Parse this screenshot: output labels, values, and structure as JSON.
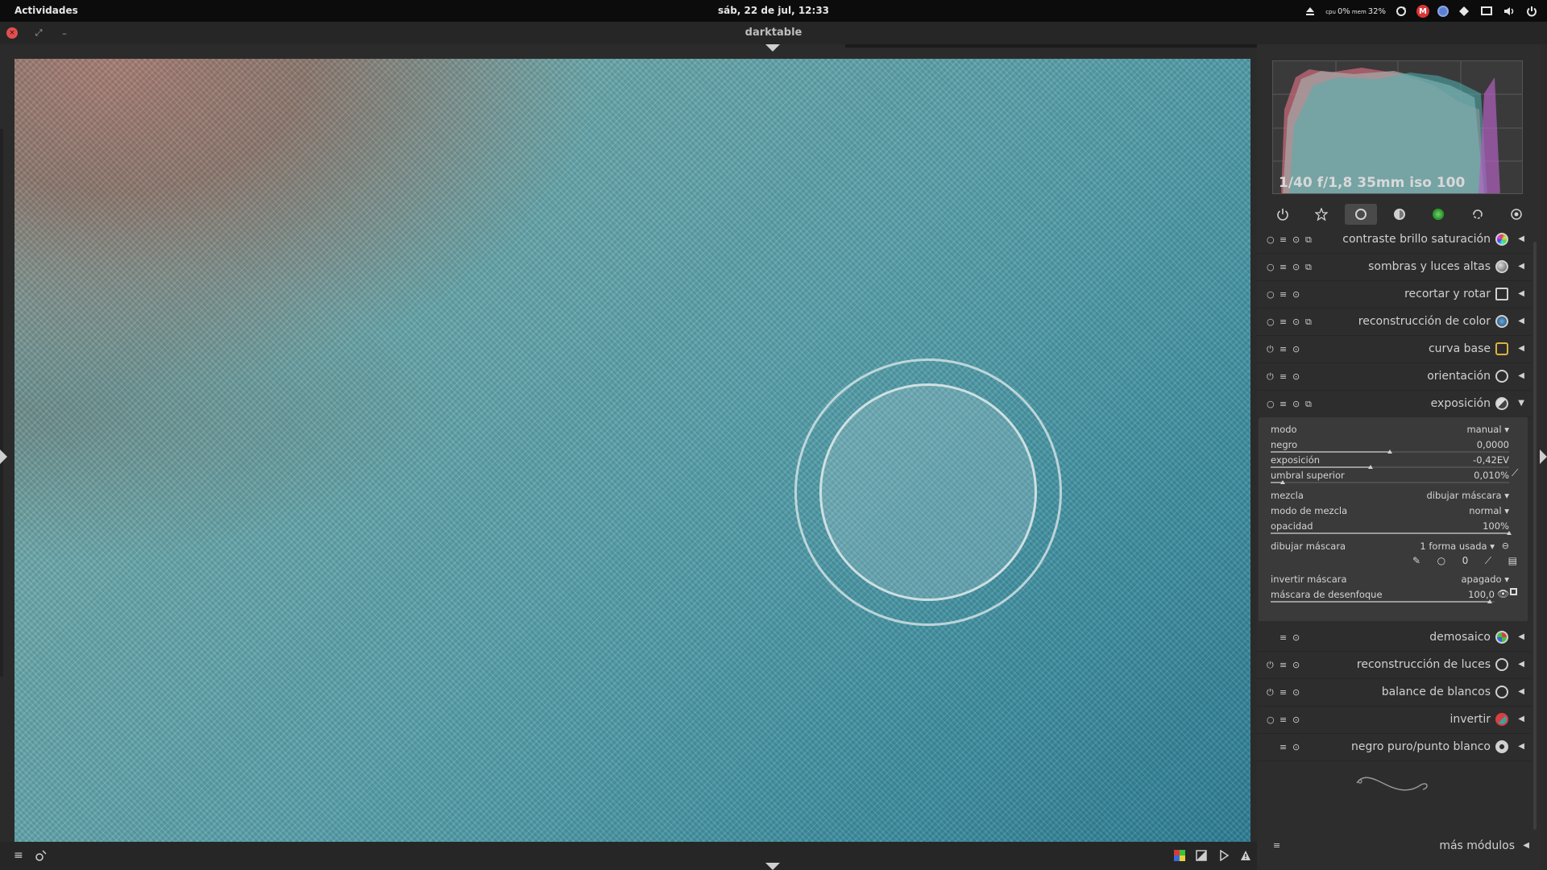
{
  "topbar": {
    "activities": "Actividades",
    "clock": "sáb, 22 de jul, 12:33",
    "cpu_label": "cpu",
    "cpu_value": "0%",
    "mem_label": "mem",
    "mem_value": "32%",
    "gmail_letter": "M"
  },
  "window": {
    "title": "darktable",
    "close_glyph": "×",
    "restore_glyph": "⤢",
    "minimize_glyph": "–"
  },
  "histogram": {
    "exif": "1/40 f/1,8 35mm iso 100"
  },
  "module_groups": [
    "power",
    "favorites",
    "base",
    "tone",
    "color",
    "correct",
    "effect"
  ],
  "modules_top": [
    {
      "name": "contraste brillo saturación",
      "icon": "color-wheel-icon"
    },
    {
      "name": "sombras y luces altas",
      "icon": "sphere-icon"
    },
    {
      "name": "recortar y rotar",
      "icon": "crop-icon"
    },
    {
      "name": "reconstrucción de color",
      "icon": "color-reconstruct-icon"
    },
    {
      "name": "curva base",
      "icon": "curve-icon"
    },
    {
      "name": "orientación",
      "icon": "orientation-icon"
    },
    {
      "name": "exposición",
      "icon": "exposure-icon"
    }
  ],
  "exposure": {
    "modo_label": "modo",
    "modo_value": "manual",
    "negro_label": "negro",
    "negro_value": "0,0000",
    "exposicion_label": "exposición",
    "exposicion_value": "-0,42EV",
    "umbral_label": "umbral superior",
    "umbral_value": "0,010%",
    "mezcla_label": "mezcla",
    "mezcla_value": "dibujar máscara",
    "modo_mezcla_label": "modo de mezcla",
    "modo_mezcla_value": "normal",
    "opacidad_label": "opacidad",
    "opacidad_value": "100%",
    "dibujar_label": "dibujar máscara",
    "dibujar_value": "1 forma usada",
    "invertir_label": "invertir máscara",
    "invertir_value": "apagado",
    "desenfoque_label": "máscara de desenfoque",
    "desenfoque_value": "100,0",
    "shape_oval_glyph": "0"
  },
  "sliders": {
    "negro": 0.5,
    "exposicion": 0.42,
    "umbral": 0.05,
    "opacidad": 1.0,
    "desenfoque": 0.98
  },
  "modules_bottom": [
    {
      "name": "demosaico",
      "icon": "demosaic-icon"
    },
    {
      "name": "reconstrucción de luces",
      "icon": "highlight-icon"
    },
    {
      "name": "balance de blancos",
      "icon": "white-balance-icon"
    },
    {
      "name": "invertir",
      "icon": "invert-icon"
    },
    {
      "name": "negro puro/punto blanco",
      "icon": "levels-icon"
    }
  ],
  "more_modules": "más módulos",
  "colors": {
    "accent": "#4a4a4a",
    "panel": "#2d2d2d",
    "expanded": "#3a3a3a"
  }
}
